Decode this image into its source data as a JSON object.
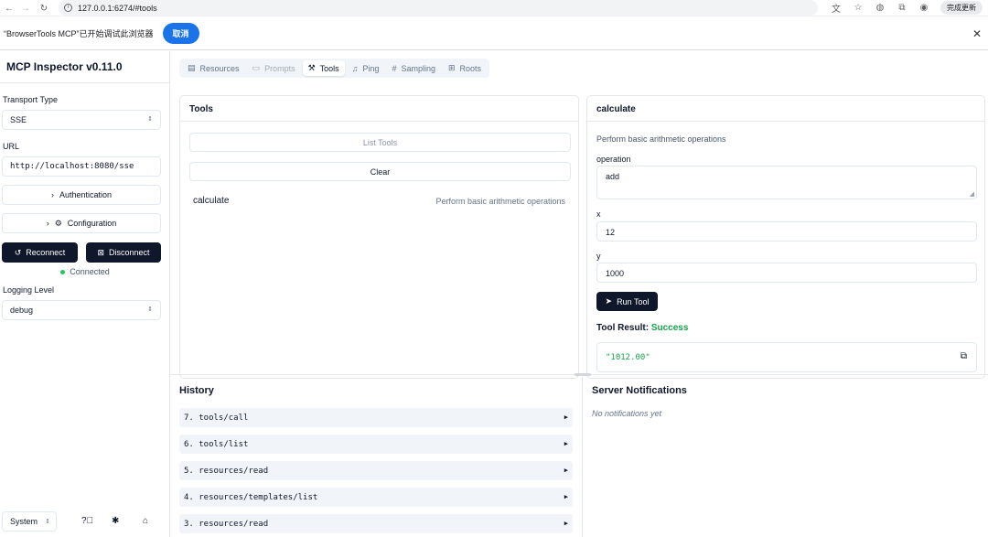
{
  "browser": {
    "url": "127.0.0.1:6274/#tools",
    "update_label": "完成更新"
  },
  "banner": {
    "message": "“BrowserTools MCP”已开始调试此浏览器",
    "cancel_label": "取消"
  },
  "sidebar": {
    "title": "MCP Inspector v0.11.0",
    "transport_label": "Transport Type",
    "transport_value": "SSE",
    "url_label": "URL",
    "url_value": "http://localhost:8080/sse",
    "authentication_label": "Authentication",
    "configuration_label": "Configuration",
    "reconnect_label": "Reconnect",
    "disconnect_label": "Disconnect",
    "status": "Connected",
    "logging_label": "Logging Level",
    "logging_value": "debug",
    "theme_value": "System"
  },
  "tabs": [
    {
      "label": "Resources",
      "icon": "files-icon"
    },
    {
      "label": "Prompts",
      "icon": "message-icon"
    },
    {
      "label": "Tools",
      "icon": "hammer-icon"
    },
    {
      "label": "Ping",
      "icon": "bell-icon"
    },
    {
      "label": "Sampling",
      "icon": "hash-icon"
    },
    {
      "label": "Roots",
      "icon": "folder-tree-icon"
    }
  ],
  "tools_panel": {
    "title": "Tools",
    "list_label": "List Tools",
    "clear_label": "Clear",
    "items": [
      {
        "name": "calculate",
        "description": "Perform basic arithmetic operations"
      }
    ]
  },
  "detail_panel": {
    "title": "calculate",
    "description": "Perform basic arithmetic operations",
    "fields": [
      {
        "label": "operation",
        "value": "add"
      },
      {
        "label": "x",
        "value": "12"
      },
      {
        "label": "y",
        "value": "1000"
      }
    ],
    "run_label": "Run Tool",
    "result_label": "Tool Result:",
    "result_status": "Success",
    "result_value": "\"1012.00\""
  },
  "history": {
    "title": "History",
    "items": [
      "7. tools/call",
      "6. tools/list",
      "5. resources/read",
      "4. resources/templates/list",
      "3. resources/read"
    ]
  },
  "notifications": {
    "title": "Server Notifications",
    "empty": "No notifications yet"
  },
  "colors": {
    "primary_dark": "#0f172a",
    "success": "#16a34a",
    "chrome_blue": "#1a73e8"
  }
}
